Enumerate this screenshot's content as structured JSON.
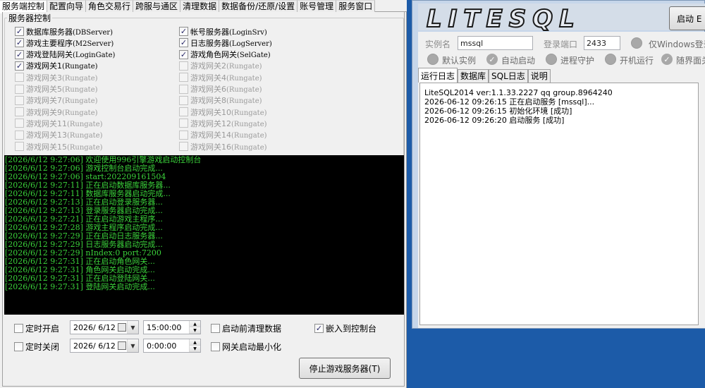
{
  "left": {
    "tabs": [
      "服务端控制",
      "配置向导",
      "角色交易行",
      "跨服与通区",
      "清理数据",
      "数据备份/还原/设置",
      "账号管理",
      "服务窗口"
    ],
    "group_title": "服务器控制",
    "services": [
      {
        "name": "数据库服务器",
        "sub": "(DBServer)",
        "checked": true,
        "enabled": true
      },
      {
        "name": "帐号服务器",
        "sub": "(LoginSrv)",
        "checked": true,
        "enabled": true
      },
      {
        "name": "游戏主要程序",
        "sub": "(M2Server)",
        "checked": true,
        "enabled": true
      },
      {
        "name": "日志服务器",
        "sub": "(LogServer)",
        "checked": true,
        "enabled": true
      },
      {
        "name": "游戏登陆网关",
        "sub": "(LoginGate)",
        "checked": true,
        "enabled": true
      },
      {
        "name": "游戏角色网关",
        "sub": "(SelGate)",
        "checked": true,
        "enabled": true
      },
      {
        "name": "游戏网关1",
        "sub": "(Rungate)",
        "checked": true,
        "enabled": true
      },
      {
        "name": "游戏网关2",
        "sub": "(Rungate)",
        "checked": false,
        "enabled": false
      },
      {
        "name": "游戏网关3",
        "sub": "(Rungate)",
        "checked": false,
        "enabled": false
      },
      {
        "name": "游戏网关4",
        "sub": "(Rungate)",
        "checked": false,
        "enabled": false
      },
      {
        "name": "游戏网关5",
        "sub": "(Rungate)",
        "checked": false,
        "enabled": false
      },
      {
        "name": "游戏网关6",
        "sub": "(Rungate)",
        "checked": false,
        "enabled": false
      },
      {
        "name": "游戏网关7",
        "sub": "(Rungate)",
        "checked": false,
        "enabled": false
      },
      {
        "name": "游戏网关8",
        "sub": "(Rungate)",
        "checked": false,
        "enabled": false
      },
      {
        "name": "游戏网关9",
        "sub": "(Rungate)",
        "checked": false,
        "enabled": false
      },
      {
        "name": "游戏网关10",
        "sub": "(Rungate)",
        "checked": false,
        "enabled": false
      },
      {
        "name": "游戏网关11",
        "sub": "(Rungate)",
        "checked": false,
        "enabled": false
      },
      {
        "name": "游戏网关12",
        "sub": "(Rungate)",
        "checked": false,
        "enabled": false
      },
      {
        "name": "游戏网关13",
        "sub": "(Rungate)",
        "checked": false,
        "enabled": false
      },
      {
        "name": "游戏网关14",
        "sub": "(Rungate)",
        "checked": false,
        "enabled": false
      },
      {
        "name": "游戏网关15",
        "sub": "(Rungate)",
        "checked": false,
        "enabled": false
      },
      {
        "name": "游戏网关16",
        "sub": "(Rungate)",
        "checked": false,
        "enabled": false
      }
    ],
    "console": [
      "[2026/6/12 9:27:06] 欢迎使用996引擎游戏启动控制台",
      "[2026/6/12 9:27:06] 游戏控制台启动完成...",
      "[2026/6/12 9:27:06] start:202209161504",
      "[2026/6/12 9:27:11] 正在启动数据库服务器...",
      "[2026/6/12 9:27:11] 数据库服务器启动完成...",
      "[2026/6/12 9:27:13] 正在启动登录服务器...",
      "[2026/6/12 9:27:13] 登录服务器启动完成...",
      "[2026/6/12 9:27:21] 正在启动游戏主程序...",
      "[2026/6/12 9:27:28] 游戏主程序启动完成...",
      "[2026/6/12 9:27:29] 正在启动日志服务器...",
      "[2026/6/12 9:27:29] 日志服务器启动完成...",
      "[2026/6/12 9:27:29] nIndex:0 port:7200",
      "[2026/6/12 9:27:31] 正在启动角色网关...",
      "[2026/6/12 9:27:31] 角色网关启动完成...",
      "[2026/6/12 9:27:31] 正在启动登陆网关...",
      "[2026/6/12 9:27:31] 登陆网关启动完成..."
    ],
    "bottom": {
      "timed_start_label": "定时开启",
      "timed_stop_label": "定时关闭",
      "start_date": "2026/ 6/12",
      "start_time": "15:00:00",
      "stop_date": "2026/ 6/12",
      "stop_time": "0:00:00",
      "clear_before_start_label": "启动前清理数据",
      "gate_minimize_label": "网关启动最小化",
      "embed_console_label": "嵌入到控制台",
      "embed_console_checked": true,
      "stop_button_label": "停止游戏服务器(T)"
    }
  },
  "right": {
    "logo_text": "LITESQL",
    "start_button_label": "启动 E",
    "instance_label": "实例名",
    "instance_value": "mssql",
    "port_label": "登录端口",
    "port_value": "2433",
    "windows_login_label": "仅Windows登录",
    "options": [
      "默认实例",
      "自动启动",
      "进程守护",
      "开机运行",
      "随界面关"
    ],
    "tabs": [
      "运行日志",
      "数据库",
      "SQL日志",
      "说明"
    ],
    "log": [
      "LiteSQL2014 ver:1.1.33.2227 qq group.8964240",
      "2026-06-12 09:26:15 正在启动服务 [mssql]...",
      "2026-06-12 09:26:15 初始化环境 [成功]",
      "2026-06-12 09:26:20 启动服务 [成功]"
    ]
  }
}
